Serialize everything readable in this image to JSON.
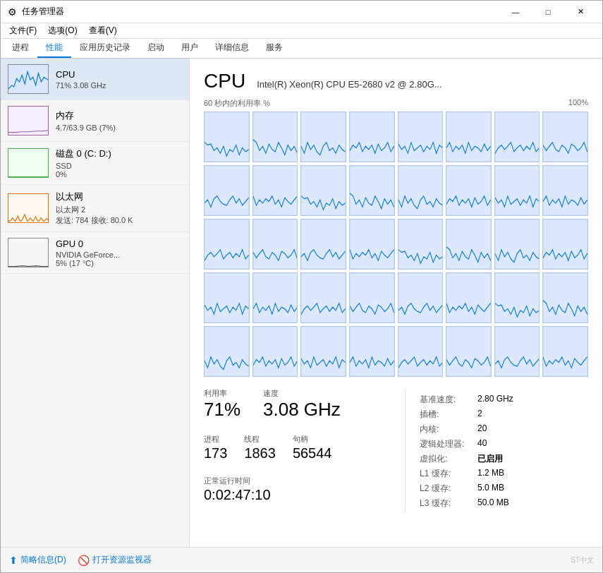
{
  "window": {
    "title": "任务管理器",
    "icon": "⚙"
  },
  "title_buttons": {
    "minimize": "—",
    "maximize": "□",
    "close": "✕"
  },
  "menu": {
    "items": [
      "文件(F)",
      "选项(O)",
      "查看(V)"
    ]
  },
  "tabs": {
    "items": [
      "进程",
      "性能",
      "应用历史记录",
      "启动",
      "用户",
      "详细信息",
      "服务"
    ],
    "active": "性能"
  },
  "sidebar": {
    "items": [
      {
        "id": "cpu",
        "label": "CPU",
        "stat1": "71% 3.08 GHz",
        "active": true,
        "color": "#0078d7"
      },
      {
        "id": "memory",
        "label": "内存",
        "stat1": "4.7/63.9 GB (7%)",
        "active": false,
        "color": "#9b30c0"
      },
      {
        "id": "disk",
        "label": "磁盘 0 (C: D:)",
        "stat1": "SSD",
        "stat2": "0%",
        "active": false,
        "color": "#4caf50"
      },
      {
        "id": "ethernet",
        "label": "以太网",
        "stat1": "以太网 2",
        "stat2": "发送: 784 接收: 80.0 K",
        "active": false,
        "color": "#e07000"
      },
      {
        "id": "gpu",
        "label": "GPU 0",
        "stat1": "NVIDIA GeForce...",
        "stat2": "5% (17 °C)",
        "active": false,
        "color": "#555"
      }
    ]
  },
  "main": {
    "title": "CPU",
    "subtitle": "Intel(R) Xeon(R) CPU E5-2680 v2 @ 2.80G...",
    "chart_label_left": "60 秒内的利用率 %",
    "chart_label_right": "100%",
    "stats": {
      "utilization_label": "利用率",
      "utilization_value": "71%",
      "speed_label": "速度",
      "speed_value": "3.08 GHz",
      "processes_label": "进程",
      "processes_value": "173",
      "threads_label": "线程",
      "threads_value": "1863",
      "handles_label": "句柄",
      "handles_value": "56544",
      "uptime_label": "正常运行时间",
      "uptime_value": "0:02:47:10"
    },
    "details": {
      "base_speed_label": "基准速度:",
      "base_speed_value": "2.80 GHz",
      "sockets_label": "插槽:",
      "sockets_value": "2",
      "cores_label": "内核:",
      "cores_value": "20",
      "logical_label": "逻辑处理器:",
      "logical_value": "40",
      "virtualization_label": "虚拟化:",
      "virtualization_value": "已启用",
      "l1_label": "L1 缓存:",
      "l1_value": "1.2 MB",
      "l2_label": "L2 缓存:",
      "l2_value": "5.0 MB",
      "l3_label": "L3 缓存:",
      "l3_value": "50.0 MB"
    }
  },
  "bottom": {
    "summary_label": "简略信息(D)",
    "monitor_label": "打开资源监视器"
  }
}
